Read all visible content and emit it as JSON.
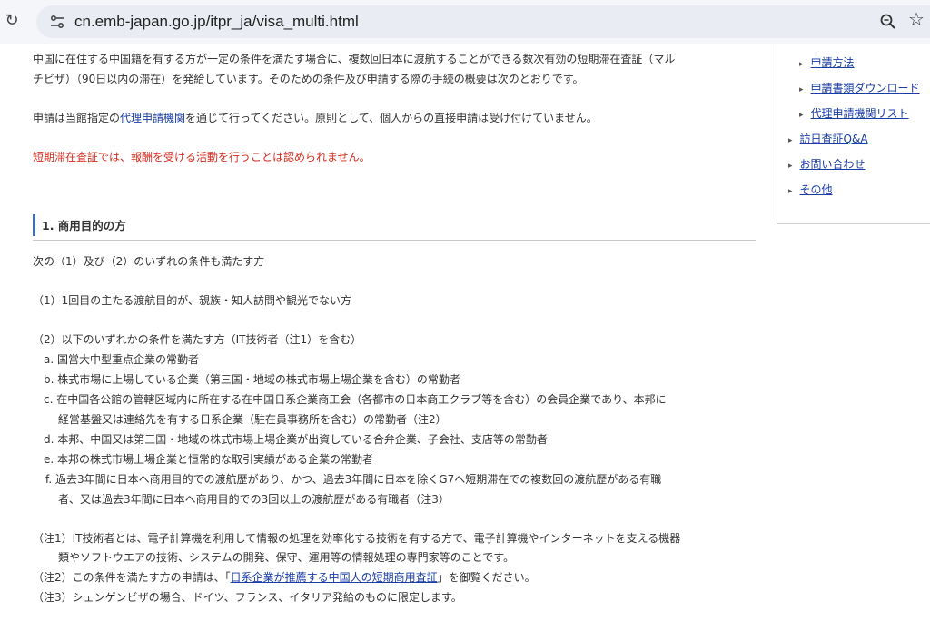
{
  "browser": {
    "url": "cn.emb-japan.go.jp/itpr_ja/visa_multi.html"
  },
  "intro": {
    "line1": "中国に在住する中国籍を有する方が一定の条件を満たす場合に、複数回日本に渡航することができる数次有効の短期滞在査証（マル",
    "line2": "チビザ）（90日以内の滞在）を発給しています。そのための条件及び申請する際の手続の概要は次のとおりです。",
    "apply_pre": "申請は当館指定の",
    "apply_link": "代理申請機関",
    "apply_post": "を通じて行ってください。原則として、個人からの直接申請は受け付けていません。",
    "warning": "短期滞在査証では、報酬を受ける活動を行うことは認められません。"
  },
  "section": {
    "heading": "1. 商用目的の方",
    "lead": "次の（1）及び（2）のいずれの条件も満たす方",
    "cond1": "（1）1回目の主たる渡航目的が、親族・知人訪問や観光でない方",
    "cond2": "（2）以下のいずれかの条件を満たす方（IT技術者（注1）を含む）",
    "items": [
      "a. 国営大中型重点企業の常勤者",
      "b. 株式市場に上場している企業（第三国・地域の株式市場上場企業を含む）の常勤者",
      "c. 在中国各公館の管轄区域内に所在する在中国日系企業商工会（各都市の日本商工クラブ等を含む）の会員企業であり、本邦に",
      "経営基盤又は連絡先を有する日系企業（駐在員事務所を含む）の常勤者（注2）",
      "d. 本邦、中国又は第三国・地域の株式市場上場企業が出資している合弁企業、子会社、支店等の常勤者",
      "e. 本邦の株式市場上場企業と恒常的な取引実績がある企業の常勤者",
      "f. 過去3年間に日本へ商用目的での渡航歴があり、かつ、過去3年間に日本を除くG7へ短期滞在での複数回の渡航歴がある有職",
      "者、又は過去3年間に日本へ商用目的での3回以上の渡航歴がある有職者（注3）"
    ]
  },
  "notes": {
    "n1_line1": "（注1）IT技術者とは、電子計算機を利用して情報の処理を効率化する技術を有する方で、電子計算機やインターネットを支える機器",
    "n1_line2": "類やソフトウエアの技術、システムの開発、保守、運用等の情報処理の専門家等のことです。",
    "n2_pre": "（注2）この条件を満たす方の申請は、「",
    "n2_link": "日系企業が推薦する中国人の短期商用査証",
    "n2_post": "」を御覧ください。",
    "n3": "（注3）シェンゲンビザの場合、ドイツ、フランス、イタリア発給のものに限定します。"
  },
  "sidebar": {
    "items": [
      {
        "label": "申請方法"
      },
      {
        "label": "申請書類ダウンロード"
      },
      {
        "label": "代理申請機関リスト"
      },
      {
        "label": "訪日査証Q&A"
      },
      {
        "label": "お問い合わせ"
      },
      {
        "label": "その他"
      }
    ]
  },
  "colors": {
    "link": "#1a3da6",
    "warning": "#d62c1f",
    "heading_bar": "#3d6fb5"
  }
}
